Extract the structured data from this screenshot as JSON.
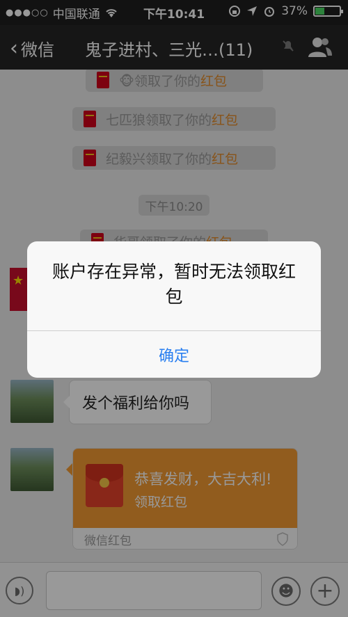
{
  "status_bar": {
    "signal": "●●●○○",
    "carrier": "中国联通",
    "time": "下午10:41",
    "battery_percent": "37%",
    "battery_level": 0.37
  },
  "nav": {
    "back_label": "微信",
    "title": "鬼子进村、三光…(11)"
  },
  "chat": {
    "system_messages": [
      {
        "prefix": "🐵领取了你的",
        "highlight": "红包"
      },
      {
        "prefix": "七匹狼领取了你的",
        "highlight": "红包"
      },
      {
        "prefix": "纪毅兴领取了你的",
        "highlight": "红包"
      },
      {
        "prefix": "华哥领取了你的",
        "highlight": "红包"
      }
    ],
    "time_label": "下午10:20",
    "text_message": "发个福利给你吗",
    "red_packet": {
      "title": "恭喜发财，大吉大利!",
      "subtitle": "领取红包",
      "footer": "微信红包"
    }
  },
  "alert": {
    "message": "账户存在异常，暂时无法领取红包",
    "confirm_label": "确定"
  },
  "colors": {
    "accent_orange": "#f29a33",
    "highlight_orange": "#e38c2c",
    "link_blue": "#2a7ff0",
    "battery_green": "#4cd964"
  }
}
